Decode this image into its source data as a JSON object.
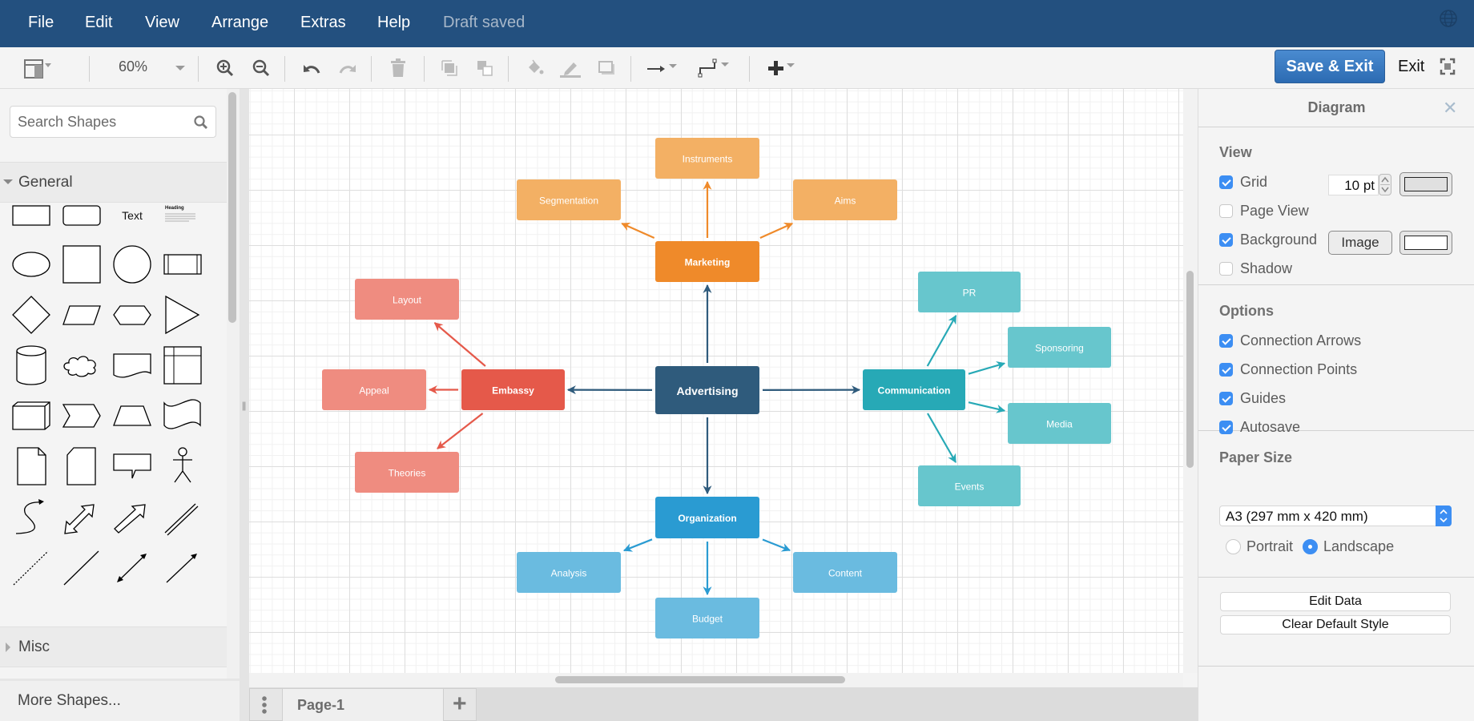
{
  "menubar": {
    "items": [
      "File",
      "Edit",
      "View",
      "Arrange",
      "Extras",
      "Help"
    ],
    "status": "Draft saved"
  },
  "toolbar": {
    "zoom": "60%",
    "save_exit": "Save & Exit",
    "exit": "Exit"
  },
  "sidebar": {
    "search_placeholder": "Search Shapes",
    "sections": [
      {
        "label": "General",
        "expanded": true
      },
      {
        "label": "Misc",
        "expanded": false
      }
    ],
    "text_shape_label": "Text",
    "heading_shape_label": "Heading",
    "more_shapes": "More Shapes..."
  },
  "pages": {
    "tabs": [
      "Page-1"
    ]
  },
  "diagram": {
    "colors": {
      "center": "#2f5b7c",
      "marketing": "#ef8a2a",
      "marketing_child": "#f3b064",
      "embassy": "#e5594a",
      "embassy_child": "#ef8c80",
      "communication": "#27a9b6",
      "communication_child": "#67c6cd",
      "organization": "#2a9bd2",
      "organization_child": "#6abbe0"
    },
    "nodes": [
      {
        "id": "advertising",
        "label": "Advertising",
        "group": "center"
      },
      {
        "id": "marketing",
        "label": "Marketing",
        "group": "marketing"
      },
      {
        "id": "instruments",
        "label": "Instruments",
        "group": "marketing_child"
      },
      {
        "id": "segmentation",
        "label": "Segmentation",
        "group": "marketing_child"
      },
      {
        "id": "aims",
        "label": "Aims",
        "group": "marketing_child"
      },
      {
        "id": "embassy",
        "label": "Embassy",
        "group": "embassy"
      },
      {
        "id": "layout",
        "label": "Layout",
        "group": "embassy_child"
      },
      {
        "id": "appeal",
        "label": "Appeal",
        "group": "embassy_child"
      },
      {
        "id": "theories",
        "label": "Theories",
        "group": "embassy_child"
      },
      {
        "id": "communication",
        "label": "Communication",
        "group": "communication"
      },
      {
        "id": "pr",
        "label": "PR",
        "group": "communication_child"
      },
      {
        "id": "sponsoring",
        "label": "Sponsoring",
        "group": "communication_child"
      },
      {
        "id": "media",
        "label": "Media",
        "group": "communication_child"
      },
      {
        "id": "events",
        "label": "Events",
        "group": "communication_child"
      },
      {
        "id": "organization",
        "label": "Organization",
        "group": "organization"
      },
      {
        "id": "analysis",
        "label": "Analysis",
        "group": "organization_child"
      },
      {
        "id": "budget",
        "label": "Budget",
        "group": "organization_child"
      },
      {
        "id": "content",
        "label": "Content",
        "group": "organization_child"
      }
    ],
    "edges": [
      {
        "from": "advertising",
        "to": "marketing",
        "color": "center"
      },
      {
        "from": "advertising",
        "to": "embassy",
        "color": "center"
      },
      {
        "from": "advertising",
        "to": "communication",
        "color": "center"
      },
      {
        "from": "advertising",
        "to": "organization",
        "color": "center"
      },
      {
        "from": "marketing",
        "to": "instruments",
        "color": "marketing"
      },
      {
        "from": "marketing",
        "to": "segmentation",
        "color": "marketing"
      },
      {
        "from": "marketing",
        "to": "aims",
        "color": "marketing"
      },
      {
        "from": "embassy",
        "to": "layout",
        "color": "embassy"
      },
      {
        "from": "embassy",
        "to": "appeal",
        "color": "embassy"
      },
      {
        "from": "embassy",
        "to": "theories",
        "color": "embassy"
      },
      {
        "from": "communication",
        "to": "pr",
        "color": "communication"
      },
      {
        "from": "communication",
        "to": "sponsoring",
        "color": "communication"
      },
      {
        "from": "communication",
        "to": "media",
        "color": "communication"
      },
      {
        "from": "communication",
        "to": "events",
        "color": "communication"
      },
      {
        "from": "organization",
        "to": "analysis",
        "color": "organization"
      },
      {
        "from": "organization",
        "to": "budget",
        "color": "organization"
      },
      {
        "from": "organization",
        "to": "content",
        "color": "organization"
      }
    ]
  },
  "panel": {
    "title": "Diagram",
    "view": {
      "heading": "View",
      "grid": {
        "label": "Grid",
        "checked": true,
        "size": "10 pt"
      },
      "page_view": {
        "label": "Page View",
        "checked": false
      },
      "background": {
        "label": "Background",
        "checked": true,
        "image_button": "Image"
      },
      "shadow": {
        "label": "Shadow",
        "checked": false
      }
    },
    "options": {
      "heading": "Options",
      "items": [
        {
          "label": "Connection Arrows",
          "checked": true
        },
        {
          "label": "Connection Points",
          "checked": true
        },
        {
          "label": "Guides",
          "checked": true
        },
        {
          "label": "Autosave",
          "checked": true
        }
      ]
    },
    "paper": {
      "heading": "Paper Size",
      "selected": "A3 (297 mm x 420 mm)",
      "orientation": [
        {
          "label": "Portrait",
          "selected": false
        },
        {
          "label": "Landscape",
          "selected": true
        }
      ]
    },
    "buttons": {
      "edit_data": "Edit Data",
      "clear_default_style": "Clear Default Style"
    }
  }
}
